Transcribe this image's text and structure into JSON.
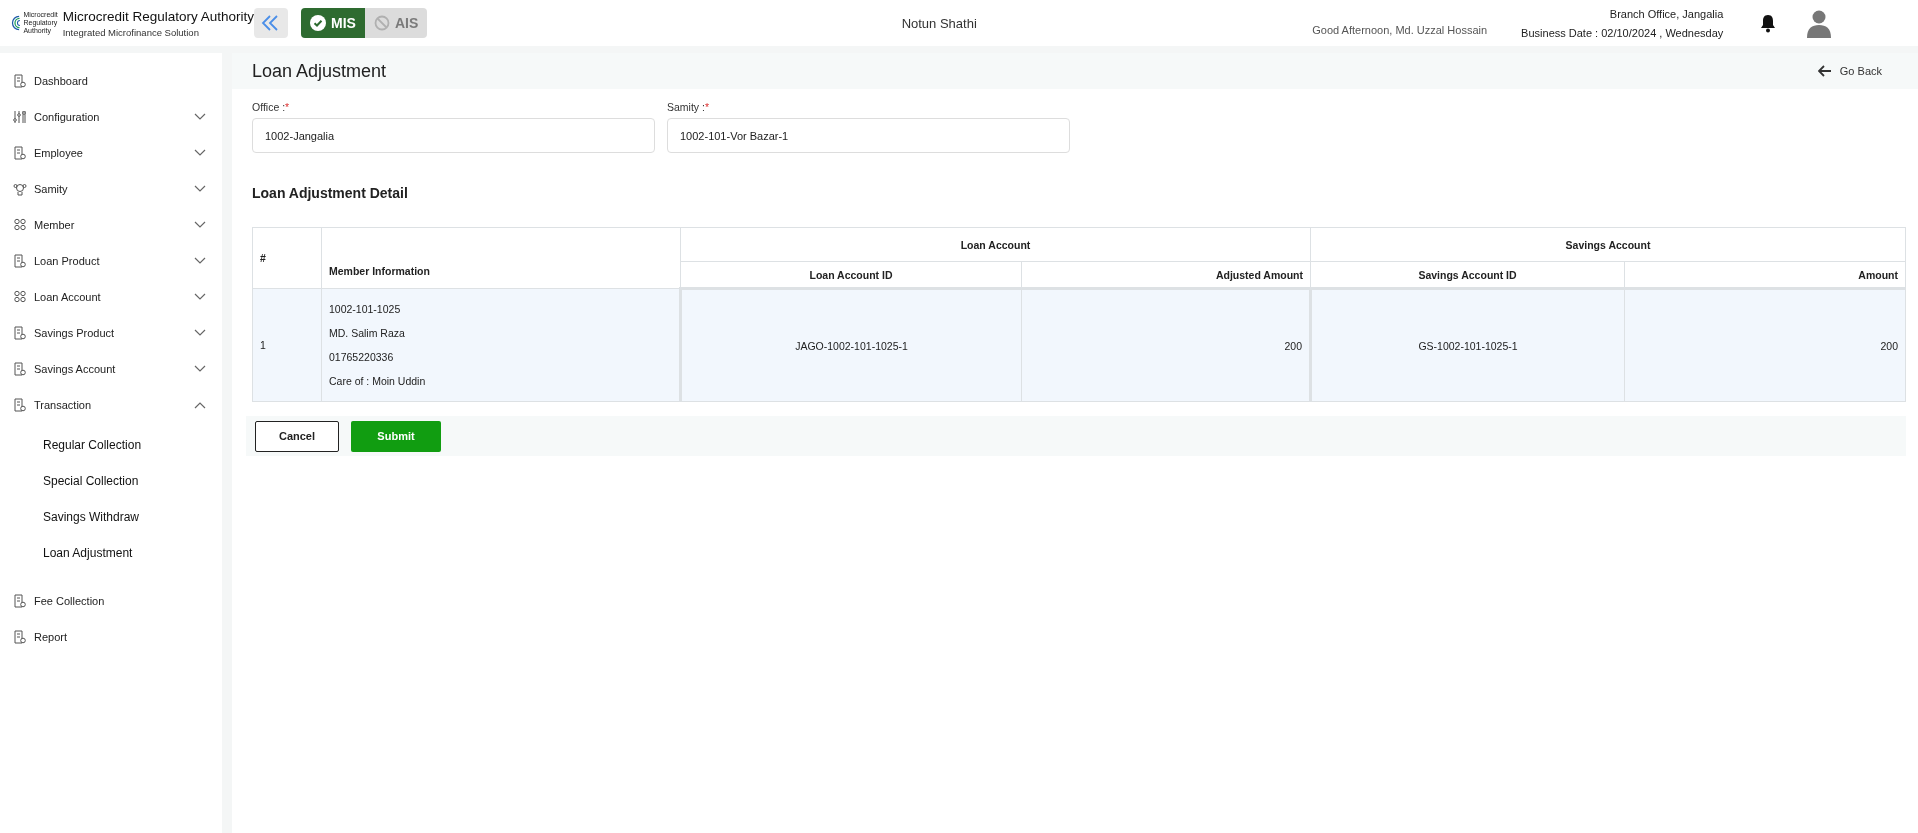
{
  "header": {
    "logo_text": [
      "Microcredit",
      "Regulatory",
      "Authority"
    ],
    "org_name": "Microcredit Regulatory Authority",
    "org_subtitle": "Integrated Microfinance Solution",
    "modes": [
      {
        "label": "MIS",
        "selected": true
      },
      {
        "label": "AIS",
        "selected": false
      }
    ],
    "app_name": "Notun Shathi",
    "greeting": "Good Afternoon, Md. Uzzal Hossain",
    "branch": "Branch Office, Jangalia",
    "business_date": "Business Date : 02/10/2024 , Wednesday"
  },
  "sidebar": {
    "items": [
      {
        "label": "Dashboard"
      },
      {
        "label": "Configuration",
        "expanded": false
      },
      {
        "label": "Employee",
        "expanded": false
      },
      {
        "label": "Samity",
        "expanded": false
      },
      {
        "label": "Member",
        "expanded": false
      },
      {
        "label": "Loan Product",
        "expanded": false
      },
      {
        "label": "Loan Account",
        "expanded": false
      },
      {
        "label": "Savings Product",
        "expanded": false
      },
      {
        "label": "Savings Account",
        "expanded": false
      },
      {
        "label": "Transaction",
        "expanded": true,
        "children": [
          {
            "label": "Regular Collection"
          },
          {
            "label": "Special Collection"
          },
          {
            "label": "Savings Withdraw"
          },
          {
            "label": "Loan Adjustment"
          }
        ]
      },
      {
        "label": "Fee Collection"
      },
      {
        "label": "Report"
      }
    ]
  },
  "page": {
    "title": "Loan Adjustment",
    "go_back": "Go Back",
    "fields": [
      {
        "label": "Office :",
        "required_mark": "*",
        "value": "1002-Jangalia"
      },
      {
        "label": "Samity :",
        "required_mark": "*",
        "value": "1002-101-Vor Bazar-1"
      }
    ],
    "section_title": "Loan Adjustment Detail",
    "table": {
      "col_index": "#",
      "col_member": "Member Information",
      "group_loan": "Loan Account",
      "group_savings": "Savings Account",
      "loan_columns": [
        "Loan Account ID",
        "Adjusted Amount"
      ],
      "savings_columns": [
        "Savings Account ID",
        "Amount"
      ],
      "rows": [
        {
          "index": "1",
          "member": [
            "1002-101-1025",
            "MD. Salim Raza",
            "01765220336",
            "Care of : Moin Uddin"
          ],
          "loan_account_id": "JAGO-1002-101-1025-1",
          "adjusted_amount": "200",
          "savings_account_id": "GS-1002-101-1025-1",
          "amount": "200"
        }
      ]
    },
    "buttons": [
      {
        "label": "Cancel",
        "kind": "secondary"
      },
      {
        "label": "Submit",
        "kind": "primary"
      }
    ]
  }
}
